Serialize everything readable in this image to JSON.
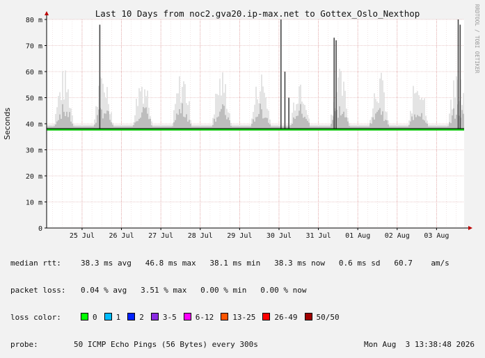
{
  "chart_data": {
    "type": "area",
    "title": "Last 10 Days from noc2.gva20.ip-max.net to Gottex_Oslo_Nexthop",
    "ylabel": "Seconds",
    "xlabel": "",
    "ylim": [
      0,
      80
    ],
    "y_ticks": [
      "0",
      "10 m",
      "20 m",
      "30 m",
      "40 m",
      "50 m",
      "60 m",
      "70 m",
      "80 m"
    ],
    "x_range_days": [
      0,
      10.6
    ],
    "x_ticks": [
      {
        "label": "25 Jul",
        "day": 0.9
      },
      {
        "label": "26 Jul",
        "day": 1.9
      },
      {
        "label": "27 Jul",
        "day": 2.9
      },
      {
        "label": "28 Jul",
        "day": 3.9
      },
      {
        "label": "29 Jul",
        "day": 4.9
      },
      {
        "label": "30 Jul",
        "day": 5.9
      },
      {
        "label": "31 Jul",
        "day": 6.9
      },
      {
        "label": "01 Aug",
        "day": 7.9
      },
      {
        "label": "02 Aug",
        "day": 8.9
      },
      {
        "label": "03 Aug",
        "day": 9.9
      }
    ],
    "grid": true,
    "median_rtt_ms": 38.1,
    "spikes": [
      {
        "day": 1.35,
        "value": 78
      },
      {
        "day": 5.95,
        "value": 80
      },
      {
        "day": 6.05,
        "value": 60
      },
      {
        "day": 6.15,
        "value": 50
      },
      {
        "day": 7.3,
        "value": 73
      },
      {
        "day": 7.35,
        "value": 72
      },
      {
        "day": 10.45,
        "value": 80
      },
      {
        "day": 10.5,
        "value": 78
      }
    ],
    "credit": "RRDTOOL / TOBI OETIKER"
  },
  "stats": {
    "median_rtt": {
      "label": "median rtt:",
      "text": "38.3 ms avg   46.8 ms max   38.1 ms min   38.3 ms now   0.6 ms sd   60.7    am/s"
    },
    "packet_loss": {
      "label": "packet loss:",
      "text": "0.04 % avg   3.51 % max   0.00 % min   0.00 % now"
    },
    "loss_color": {
      "label": "loss color:",
      "items": [
        {
          "label": "0",
          "color": "#00ff00"
        },
        {
          "label": "1",
          "color": "#00bbff"
        },
        {
          "label": "2",
          "color": "#0022ff"
        },
        {
          "label": "3-5",
          "color": "#8a2be2"
        },
        {
          "label": "6-12",
          "color": "#ff00ff"
        },
        {
          "label": "13-25",
          "color": "#ff5500"
        },
        {
          "label": "26-49",
          "color": "#ff0000"
        },
        {
          "label": "50/50",
          "color": "#a10000"
        }
      ]
    },
    "probe": {
      "label": "probe:",
      "text": "50 ICMP Echo Pings (56 Bytes) every 300s",
      "timestamp": "Mon Aug  3 13:38:48 2026"
    }
  }
}
